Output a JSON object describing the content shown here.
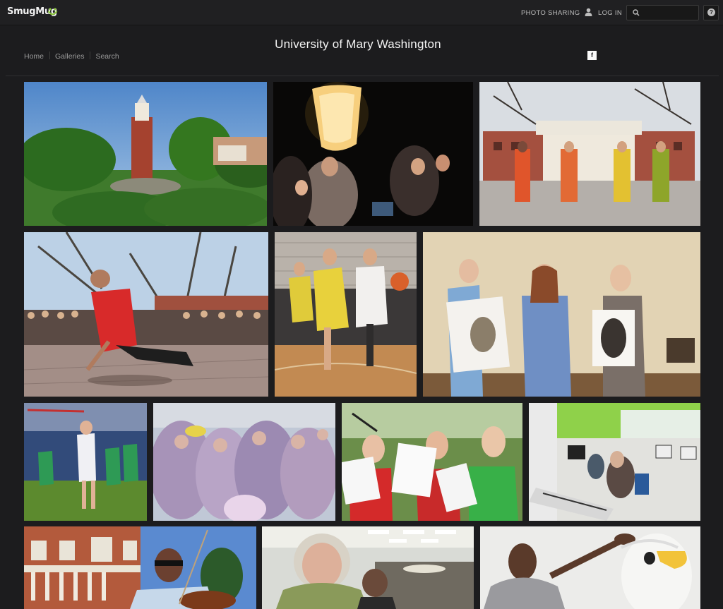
{
  "topbar": {
    "logo_text": "SmugMug",
    "photo_sharing": "PHOTO SHARING",
    "login": "LOG IN",
    "search_placeholder": "",
    "help_glyph": "?"
  },
  "header": {
    "title": "University of Mary Washington",
    "nav": [
      "Home",
      "Galleries",
      "Search"
    ],
    "facebook_glyph": "f"
  },
  "colors": {
    "background": "#1c1c1e",
    "topbar": "#202022",
    "logo_accent": "#8cc63f"
  },
  "gallery": [
    {
      "subject": "clock-tower-campus"
    },
    {
      "subject": "paper-lantern-night"
    },
    {
      "subject": "dancers-front-of-building"
    },
    {
      "subject": "breakdancer-crowd"
    },
    {
      "subject": "basketball-game"
    },
    {
      "subject": "art-presentation"
    },
    {
      "subject": "lacrosse-players"
    },
    {
      "subject": "color-festival-crowd"
    },
    {
      "subject": "singers-with-sheet-music"
    },
    {
      "subject": "computer-music-lab"
    },
    {
      "subject": "violinist-outdoors"
    },
    {
      "subject": "library-study"
    },
    {
      "subject": "eagle-mascot"
    }
  ]
}
